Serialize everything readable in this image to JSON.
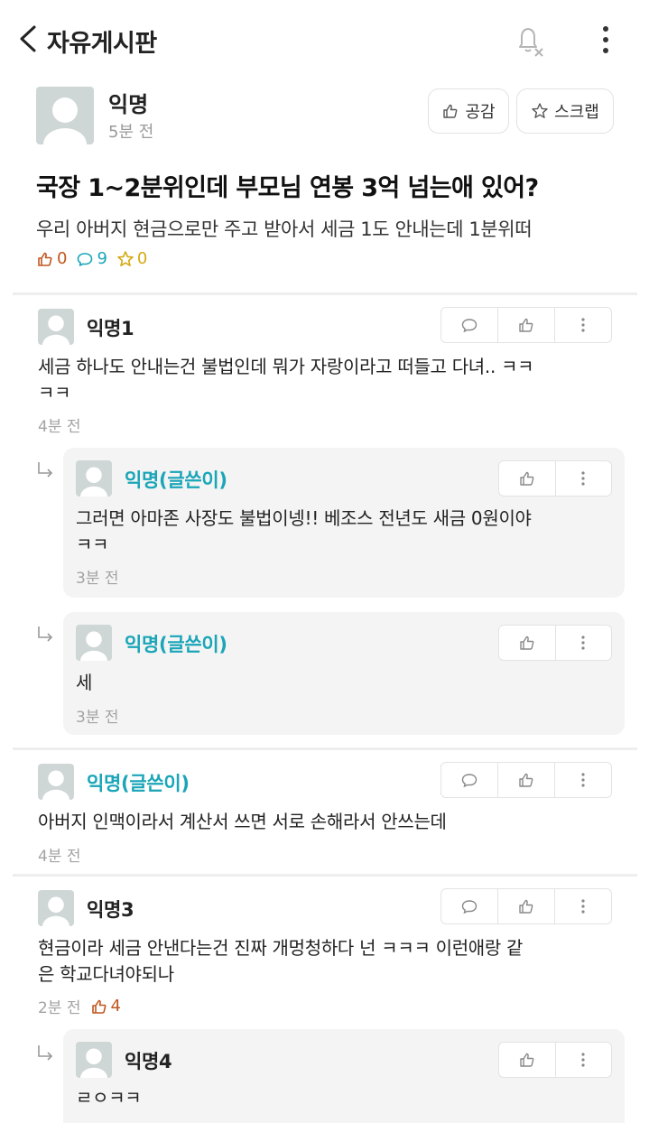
{
  "header": {
    "title": "자유게시판"
  },
  "post": {
    "author": "익명",
    "time": "5분 전",
    "like_button": "공감",
    "scrap_button": "스크랩",
    "title": "국장 1~2분위인데 부모님 연봉 3억 넘는애 있어?",
    "body": "우리 아버지 현금으로만 주고 받아서 세금 1도 안내는데 1분위떠",
    "stats": {
      "likes": "0",
      "comments": "9",
      "scraps": "0"
    }
  },
  "comments": [
    {
      "author": "익명1",
      "line1": "세금 하나도 안내는건 불법인데 뭐가 자랑이라고 떠들고 다녀.. ㅋㅋ",
      "line2": "ㅋㅋ",
      "time": "4분 전"
    },
    {
      "author": "익명(글쓴이)",
      "line1": "그러면 아마존 사장도 불법이넹!! 베조스 전년도 새금 0원이야",
      "line2": "ㅋㅋ",
      "time": "3분 전"
    },
    {
      "author": "익명(글쓴이)",
      "line1": "세",
      "time": "3분 전"
    },
    {
      "author": "익명(글쓴이)",
      "line1": "아버지 인맥이라서 계산서 쓰면 서로 손해라서 안쓰는데",
      "time": "4분 전"
    },
    {
      "author": "익명3",
      "line1": "현금이라 세금 안낸다는건 진짜 개멍청하다 넌 ㅋㅋㅋ 이런애랑 같",
      "line2": "은 학교다녀야되나",
      "time": "2분 전",
      "likes": "4"
    },
    {
      "author": "익명4",
      "line1": "ㄹㅇㅋㅋ"
    }
  ],
  "colors": {
    "teal": "#1aa5b8",
    "like": "#c0561f",
    "scrap": "#d4aa12",
    "avatar": "#cfd6d6"
  },
  "icons": [
    "chevron-left-icon",
    "bell-off-icon",
    "more-vertical-icon",
    "thumbs-up-icon",
    "star-icon",
    "comment-icon",
    "reply-arrow-icon",
    "avatar-icon"
  ]
}
